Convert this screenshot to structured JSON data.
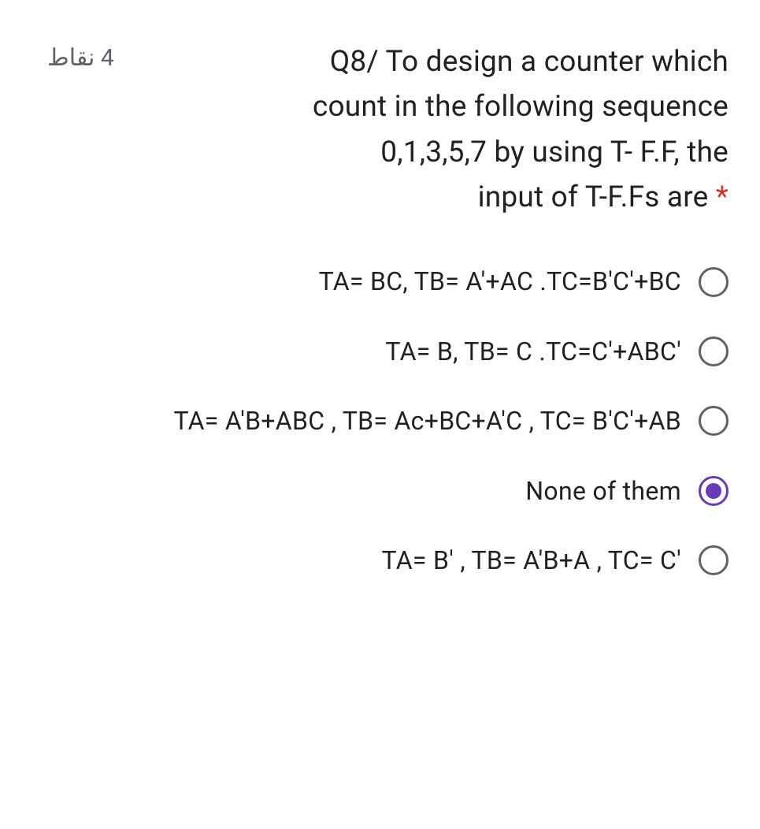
{
  "question": {
    "points": "4 نقاط",
    "text_line1": "Q8/ To design a counter which",
    "text_line2": "count in the following sequence",
    "text_line3": "0,1,3,5,7 by using T- F.F, the",
    "text_line4": "input of T-F.Fs are",
    "required_marker": "*"
  },
  "options": [
    {
      "label": "TA= BC, TB= A'+AC .TC=B'C'+BC",
      "selected": false
    },
    {
      "label": "TA= B, TB= C .TC=C'+ABC'",
      "selected": false
    },
    {
      "label": "TA= A'B+ABC , TB= Ac+BC+A'C , TC= B'C'+AB",
      "selected": false
    },
    {
      "label": "None of them",
      "selected": true
    },
    {
      "label": "TA= B' , TB= A'B+A , TC= C'",
      "selected": false
    }
  ]
}
